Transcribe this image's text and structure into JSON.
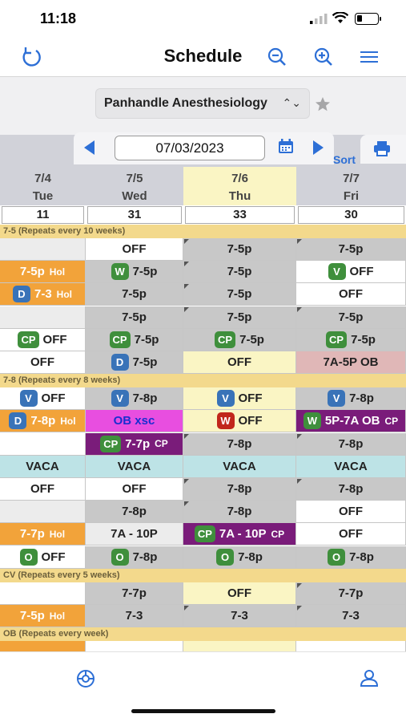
{
  "status": {
    "time": "11:18"
  },
  "nav": {
    "title": "Schedule",
    "icons": [
      "refresh-icon",
      "zoom-out-icon",
      "zoom-in-icon",
      "menu-icon"
    ]
  },
  "org": {
    "name": "Panhandle Anesthesiology"
  },
  "date": {
    "value": "07/03/2023",
    "sort_label": "Sort"
  },
  "days": [
    {
      "date": "7/4",
      "dow": "Tue",
      "count": "11"
    },
    {
      "date": "7/5",
      "dow": "Wed",
      "count": "31"
    },
    {
      "date": "7/6",
      "dow": "Thu",
      "count": "33",
      "today": true
    },
    {
      "date": "7/7",
      "dow": "Fri",
      "count": "30"
    }
  ],
  "groups": [
    {
      "label": "7-5  (Repeats every 10 weeks)"
    },
    {
      "label": "7-8  (Repeats every 8 weeks)"
    },
    {
      "label": "CV  (Repeats every 5 weeks)"
    },
    {
      "label": "OB  (Repeats every week)"
    }
  ],
  "rows": [
    {
      "cells": [
        {
          "text": "",
          "style": "light"
        },
        {
          "text": "OFF",
          "style": "white"
        },
        {
          "text": "7-5p",
          "style": "gray",
          "corner": true
        },
        {
          "text": "7-5p",
          "style": "gray",
          "corner": true
        }
      ]
    },
    {
      "cells": [
        {
          "text": "7-5p",
          "style": "orange",
          "suffix": "Hol"
        },
        {
          "text": "7-5p",
          "style": "gray",
          "badge": "W",
          "badge_style": "W"
        },
        {
          "text": "7-5p",
          "style": "gray",
          "corner": true
        },
        {
          "text": "OFF",
          "style": "white",
          "badge": "V",
          "badge_style": "O"
        }
      ]
    },
    {
      "cells": [
        {
          "text": "7-3",
          "style": "orange",
          "badge": "D",
          "badge_style": "D",
          "suffix": "Hol"
        },
        {
          "text": "7-5p",
          "style": "gray"
        },
        {
          "text": "7-5p",
          "style": "gray",
          "corner": true
        },
        {
          "text": "OFF",
          "style": "white"
        }
      ]
    },
    {
      "cells": [
        {
          "text": "",
          "style": "light"
        },
        {
          "text": "7-5p",
          "style": "gray"
        },
        {
          "text": "7-5p",
          "style": "gray",
          "corner": true
        },
        {
          "text": "7-5p",
          "style": "gray",
          "corner": true
        }
      ]
    },
    {
      "cells": [
        {
          "text": "OFF",
          "style": "white",
          "badge": "CP",
          "badge_style": "CP"
        },
        {
          "text": "7-5p",
          "style": "gray",
          "badge": "CP",
          "badge_style": "CP"
        },
        {
          "text": "7-5p",
          "style": "gray",
          "badge": "CP",
          "badge_style": "CP"
        },
        {
          "text": "7-5p",
          "style": "gray",
          "badge": "CP",
          "badge_style": "CP"
        }
      ]
    },
    {
      "cells": [
        {
          "text": "OFF",
          "style": "white"
        },
        {
          "text": "7-5p",
          "style": "gray",
          "badge": "D",
          "badge_style": "D"
        },
        {
          "text": "OFF",
          "style": "yellow"
        },
        {
          "text": "7A-5P OB",
          "style": "pink"
        }
      ]
    },
    {
      "cells": [
        {
          "text": "OFF",
          "style": "white",
          "badge": "V",
          "badge_style": "V"
        },
        {
          "text": "7-8p",
          "style": "gray",
          "badge": "V",
          "badge_style": "V"
        },
        {
          "text": "OFF",
          "style": "yellow",
          "badge": "V",
          "badge_style": "V"
        },
        {
          "text": "7-8p",
          "style": "gray",
          "badge": "V",
          "badge_style": "V"
        }
      ]
    },
    {
      "cells": [
        {
          "text": "7-8p",
          "style": "orange",
          "badge": "D",
          "badge_style": "D",
          "suffix": "Hol"
        },
        {
          "text": "OB  xsc",
          "style": "magenta"
        },
        {
          "text": "OFF",
          "style": "yellow",
          "badge": "W",
          "badge_style": "Wred"
        },
        {
          "text": "5P-7A OB",
          "style": "purple",
          "badge": "W",
          "badge_style": "W",
          "suffix": "CP"
        }
      ]
    },
    {
      "cells": [
        {
          "text": "",
          "style": "white"
        },
        {
          "text": "7-7p",
          "style": "purple",
          "badge": "CP",
          "badge_style": "CP",
          "suffix": "CP"
        },
        {
          "text": "7-8p",
          "style": "gray",
          "corner": true
        },
        {
          "text": "7-8p",
          "style": "gray",
          "corner": true
        }
      ]
    },
    {
      "cells": [
        {
          "text": "VACA",
          "style": "cyan"
        },
        {
          "text": "VACA",
          "style": "cyan"
        },
        {
          "text": "VACA",
          "style": "cyan"
        },
        {
          "text": "VACA",
          "style": "cyan"
        }
      ]
    },
    {
      "cells": [
        {
          "text": "OFF",
          "style": "white"
        },
        {
          "text": "OFF",
          "style": "white"
        },
        {
          "text": "7-8p",
          "style": "gray",
          "corner": true
        },
        {
          "text": "7-8p",
          "style": "gray",
          "corner": true
        }
      ]
    },
    {
      "cells": [
        {
          "text": "",
          "style": "light"
        },
        {
          "text": "7-8p",
          "style": "gray"
        },
        {
          "text": "7-8p",
          "style": "gray",
          "corner": true
        },
        {
          "text": "OFF",
          "style": "white"
        }
      ]
    },
    {
      "cells": [
        {
          "text": "7-7p",
          "style": "orange",
          "suffix": "Hol"
        },
        {
          "text": "7A - 10P",
          "style": "light"
        },
        {
          "text": "7A - 10P",
          "style": "purple",
          "badge": "CP",
          "badge_style": "CP",
          "suffix": "CP"
        },
        {
          "text": "OFF",
          "style": "white"
        }
      ]
    },
    {
      "cells": [
        {
          "text": "OFF",
          "style": "white",
          "badge": "O",
          "badge_style": "O"
        },
        {
          "text": "7-8p",
          "style": "gray",
          "badge": "O",
          "badge_style": "O"
        },
        {
          "text": "7-8p",
          "style": "gray",
          "badge": "O",
          "badge_style": "O"
        },
        {
          "text": "7-8p",
          "style": "gray",
          "badge": "O",
          "badge_style": "O"
        }
      ]
    },
    {
      "cells": [
        {
          "text": "",
          "style": "white"
        },
        {
          "text": "7-7p",
          "style": "gray"
        },
        {
          "text": "OFF",
          "style": "yellow"
        },
        {
          "text": "7-7p",
          "style": "gray",
          "corner": true
        }
      ]
    },
    {
      "cells": [
        {
          "text": "7-5p",
          "style": "orange",
          "suffix": "Hol"
        },
        {
          "text": "7-3",
          "style": "gray"
        },
        {
          "text": "7-3",
          "style": "gray",
          "corner": true
        },
        {
          "text": "7-3",
          "style": "gray",
          "corner": true
        }
      ]
    }
  ],
  "tabbar": {
    "icons": [
      "schedule-settings-icon",
      "profile-icon"
    ]
  },
  "colors": {
    "accent": "#2d6fd6",
    "holiday": "#f2a33a",
    "vacation": "#bde3e6",
    "group_header": "#f3d98c"
  }
}
